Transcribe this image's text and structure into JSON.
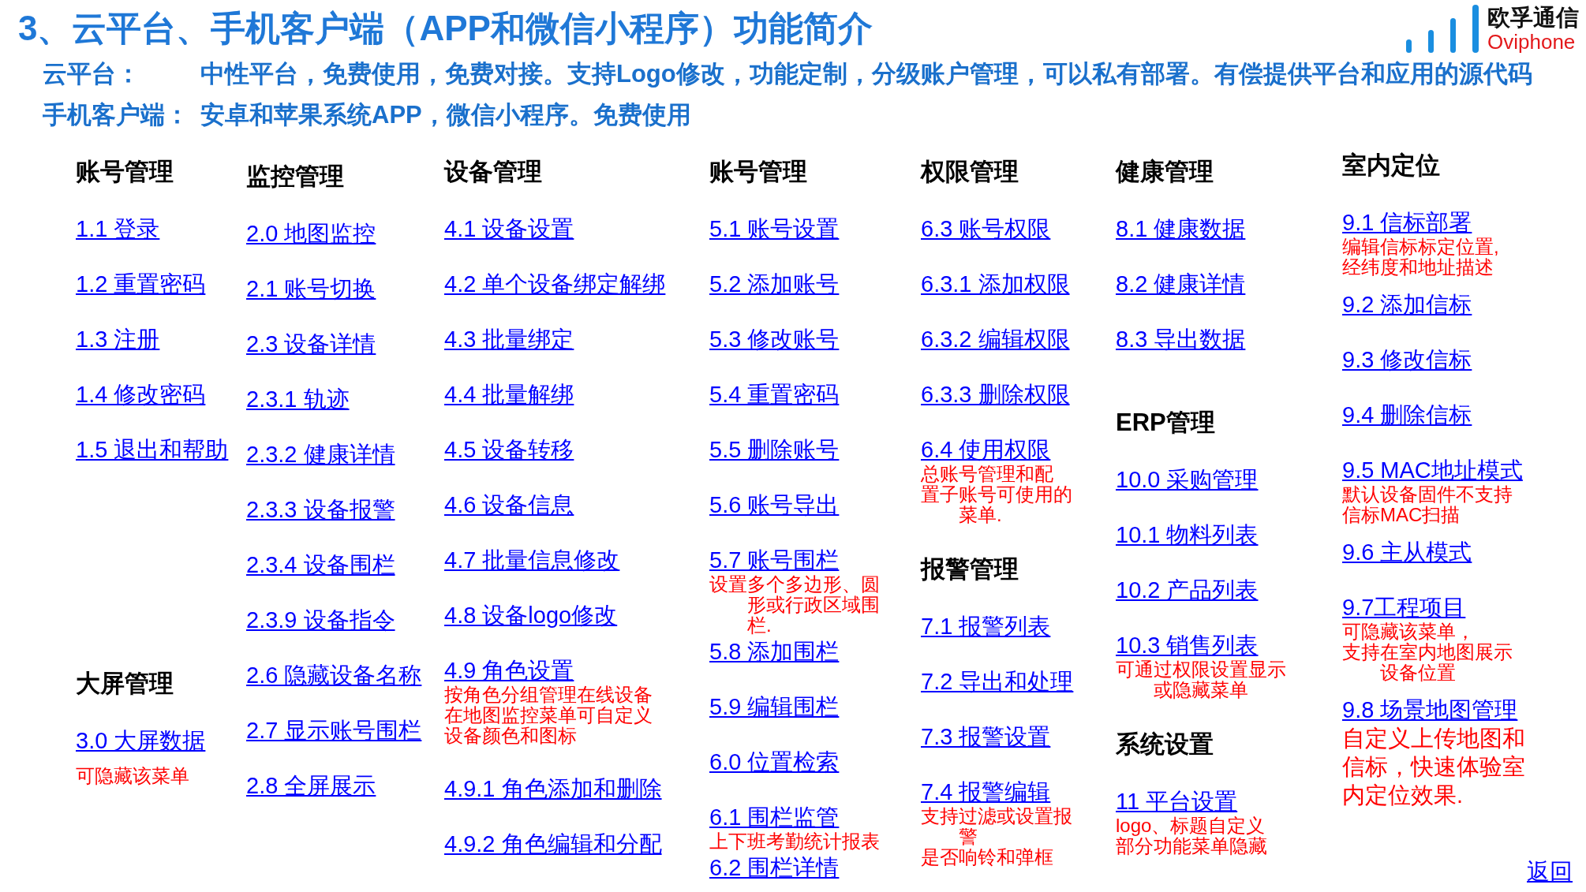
{
  "title": "3、云平台、手机客户端（APP和微信小程序）功能简介",
  "logo": {
    "name": "欧孚通信",
    "latin": "Oviphone"
  },
  "intro": [
    {
      "label": "云平台：",
      "text": "中性平台，免费使用，免费对接。支持Logo修改，功能定制，分级账户管理，可以私有部署。有偿提供平台和应用的源代码"
    },
    {
      "label": "手机客户端：",
      "text": "安卓和苹果系统APP，微信小程序。免费使用"
    }
  ],
  "columns": [
    {
      "sections": [
        {
          "heading": "账号管理",
          "links": [
            {
              "label": "1.1 登录"
            },
            {
              "label": "1.2 重置密码"
            },
            {
              "label": "1.3 注册"
            },
            {
              "label": "1.4 修改密码"
            },
            {
              "label": "1.5 退出和帮助"
            }
          ]
        },
        {
          "heading": "大屏管理",
          "links": [
            {
              "label": "3.0 大屏数据",
              "note": {
                "kind": "remark",
                "paragraphs": [
                  "可隐藏该菜单"
                ]
              }
            }
          ]
        }
      ]
    },
    {
      "sections": [
        {
          "heading": "监控管理",
          "links": [
            {
              "label": "2.0 地图监控"
            },
            {
              "label": "2.1 账号切换"
            },
            {
              "label": "2.3 设备详情"
            },
            {
              "label": "2.3.1 轨迹"
            },
            {
              "label": "2.3.2 健康详情"
            },
            {
              "label": "2.3.3 设备报警"
            },
            {
              "label": "2.3.4 设备围栏"
            },
            {
              "label": "2.3.9 设备指令"
            },
            {
              "label": "2.6 隐藏设备名称"
            },
            {
              "label": "2.7 显示账号围栏"
            },
            {
              "label": "2.8 全屏展示"
            }
          ]
        }
      ]
    },
    {
      "sections": [
        {
          "heading": "设备管理",
          "links": [
            {
              "label": "4.1 设备设置"
            },
            {
              "label": "4.2 单个设备绑定解绑"
            },
            {
              "label": "4.3 批量绑定"
            },
            {
              "label": "4.4 批量解绑"
            },
            {
              "label": "4.5 设备转移"
            },
            {
              "label": "4.6 设备信息"
            },
            {
              "label": "4.7 批量信息修改"
            },
            {
              "label": "4.8 设备logo修改"
            },
            {
              "label": "4.9 角色设置",
              "note": {
                "kind": "remark",
                "paragraphs": [
                  "按角色分组管理在线设备",
                  "在地图监控菜单可自定义",
                  "设备颜色和图标"
                ]
              }
            },
            {
              "label": "4.9.1 角色添加和删除"
            },
            {
              "label": "4.9.2 角色编辑和分配"
            }
          ]
        }
      ]
    },
    {
      "sections": [
        {
          "heading": "账号管理",
          "links": [
            {
              "label": "5.1 账号设置"
            },
            {
              "label": "5.2 添加账号"
            },
            {
              "label": "5.3 修改账号"
            },
            {
              "label": "5.4 重置密码"
            },
            {
              "label": "5.5 删除账号"
            },
            {
              "label": "5.6 账号导出"
            },
            {
              "label": "5.7 账号围栏",
              "note": {
                "kind": "remark",
                "paragraphs": [
                  "设置多个多边形、圆形或行政区域围栏."
                ]
              }
            },
            {
              "label": "5.8 添加围栏"
            },
            {
              "label": "5.9 编辑围栏"
            },
            {
              "label": "6.0 位置检索"
            },
            {
              "label": "6.1 围栏监管",
              "note": {
                "kind": "remark",
                "paragraphs": [
                  "上下班考勤统计报表"
                ]
              }
            },
            {
              "label": "6.2 围栏详情"
            }
          ]
        }
      ]
    },
    {
      "sections": [
        {
          "heading": "权限管理",
          "links": [
            {
              "label": "6.3 账号权限"
            },
            {
              "label": "6.3.1 添加权限"
            },
            {
              "label": "6.3.2 编辑权限"
            },
            {
              "label": "6.3.3 删除权限"
            },
            {
              "label": "6.4 使用权限",
              "note": {
                "kind": "remark",
                "paragraphs": [
                  "总账号管理和配",
                  "置子账号可使用的菜单."
                ]
              }
            }
          ]
        },
        {
          "heading": "报警管理",
          "links": [
            {
              "label": "7.1 报警列表"
            },
            {
              "label": "7.2 导出和处理"
            },
            {
              "label": "7.3 报警设置"
            },
            {
              "label": "7.4 报警编辑",
              "note": {
                "kind": "remark",
                "paragraphs": [
                  "支持过滤或设置报警",
                  "是否响铃和弹框"
                ]
              }
            }
          ]
        }
      ]
    },
    {
      "sections": [
        {
          "heading": "健康管理",
          "links": [
            {
              "label": "8.1 健康数据"
            },
            {
              "label": "8.2 健康详情"
            },
            {
              "label": "8.3 导出数据"
            }
          ]
        },
        {
          "heading": "ERP管理",
          "links": [
            {
              "label": "10.0 采购管理"
            },
            {
              "label": "10.1 物料列表"
            },
            {
              "label": "10.2 产品列表"
            },
            {
              "label": "10.3 销售列表",
              "note": {
                "kind": "remark",
                "paragraphs": [
                  "可通过权限设置显示或隐藏菜单"
                ]
              }
            }
          ]
        },
        {
          "heading": "系统设置",
          "links": [
            {
              "label": "11 平台设置",
              "note": {
                "kind": "remark",
                "paragraphs": [
                  "logo、标题自定义",
                  "部分功能菜单隐藏"
                ]
              }
            }
          ]
        }
      ]
    },
    {
      "sections": [
        {
          "heading": "室内定位",
          "links": [
            {
              "label": "9.1 信标部署",
              "note": {
                "kind": "remark",
                "paragraphs": [
                  "编辑信标标定位置,",
                  "经纬度和地址描述"
                ]
              }
            },
            {
              "label": "9.2 添加信标"
            },
            {
              "label": "9.3 修改信标"
            },
            {
              "label": "9.4 删除信标"
            },
            {
              "label": "9.5 MAC地址模式",
              "note": {
                "kind": "remark",
                "paragraphs": [
                  "默认设备固件不支持",
                  "信标MAC扫描"
                ]
              }
            },
            {
              "label": "9.6 主从模式"
            },
            {
              "label": "9.7工程项目",
              "note": {
                "kind": "remark",
                "paragraphs": [
                  "可隐藏该菜单，",
                  "支持在室内地图展示设备位置"
                ]
              }
            },
            {
              "label": "9.8 场景地图管理",
              "note": {
                "kind": "callout",
                "paragraphs": [
                  "自定义上传地图和信标，快速体验室内定位效果."
                ]
              }
            }
          ]
        }
      ]
    }
  ],
  "back_link": "返回"
}
